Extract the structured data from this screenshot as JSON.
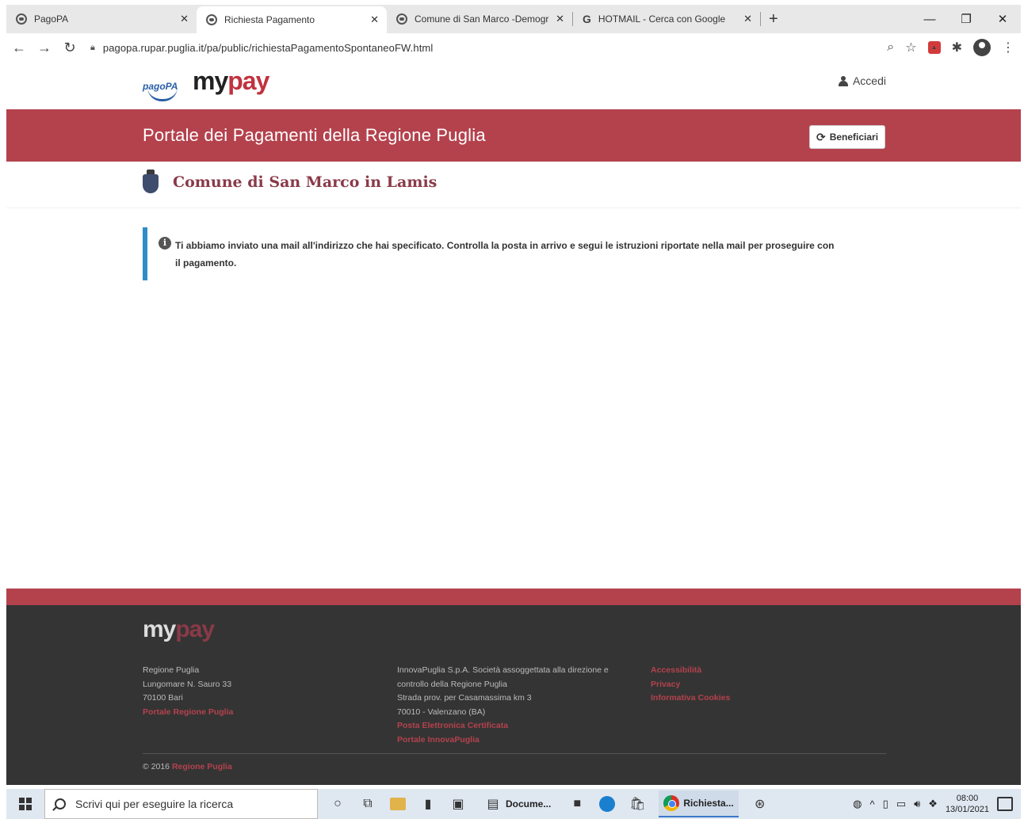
{
  "browser": {
    "tabs": [
      {
        "title": "PagoPA",
        "active": false
      },
      {
        "title": "Richiesta Pagamento",
        "active": true
      },
      {
        "title": "Comune di San Marco -Demogr",
        "active": false
      },
      {
        "title": "HOTMAIL - Cerca con Google",
        "active": false
      }
    ],
    "url": "pagopa.rupar.puglia.it/pa/public/richiestaPagamentoSpontaneoFW.html"
  },
  "header": {
    "logo_pagopa": "pagoPA",
    "logo_my": "my",
    "logo_pay": "pay",
    "login_label": "Accedi"
  },
  "banner": {
    "title": "Portale dei Pagamenti della Regione Puglia",
    "beneficiari_label": "Beneficiari"
  },
  "comune": {
    "name": "Comune di San Marco in Lamis"
  },
  "alert": {
    "message": "Ti abbiamo inviato una mail all'indirizzo che hai specificato. Controlla la posta in arrivo e segui le istruzioni riportate nella mail per proseguire con il pagamento."
  },
  "footer": {
    "logo_my": "my",
    "logo_pay": "pay",
    "col1": {
      "line1": "Regione Puglia",
      "line2": "Lungomare N. Sauro 33",
      "line3": "70100 Bari",
      "link1": "Portale Regione Puglia"
    },
    "col2": {
      "line1": "InnovaPuglia S.p.A. Società assoggettata alla direzione e",
      "line2": "controllo della Regione Puglia",
      "line3": "Strada prov. per Casamassima km 3",
      "line4": "70010 - Valenzano (BA)",
      "link1": "Posta Elettronica Certificata",
      "link2": "Portale InnovaPuglia"
    },
    "col3": {
      "link1": "Accessibilità",
      "link2": "Privacy",
      "link3": "Informativa Cookies"
    },
    "copyright": "© 2016",
    "copyright_link": "Regione Puglia"
  },
  "taskbar": {
    "search_placeholder": "Scrivi qui per eseguire la ricerca",
    "app_documents": "Docume...",
    "app_chrome": "Richiesta...",
    "time": "08:00",
    "date": "13/01/2021"
  }
}
